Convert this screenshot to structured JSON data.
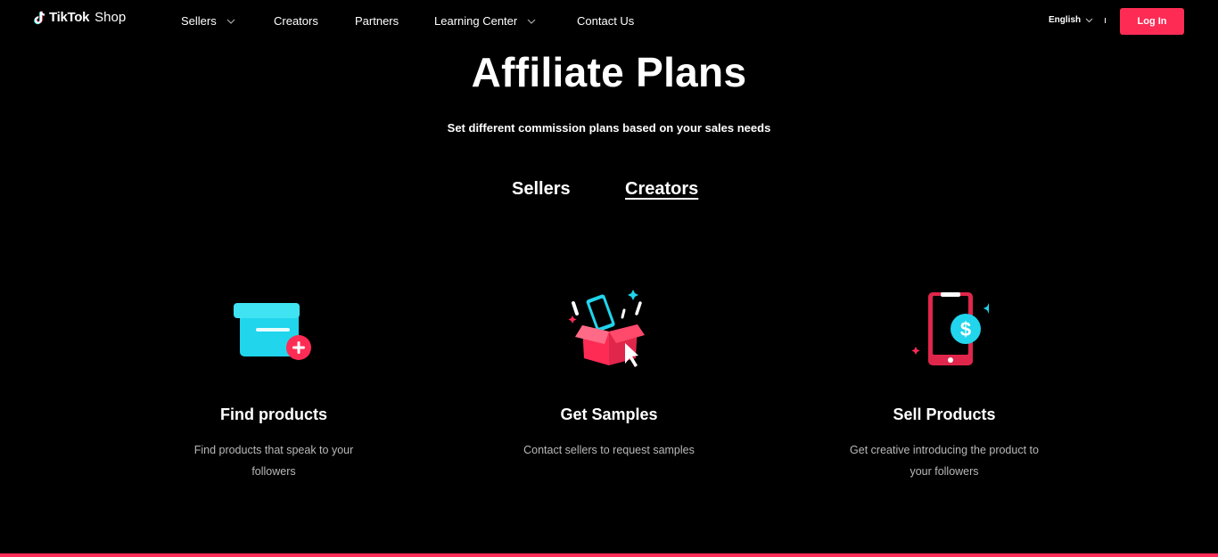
{
  "header": {
    "logo": {
      "brand": "TikTok",
      "suffix": "Shop",
      "icon": "tiktok-note-icon"
    },
    "nav": [
      {
        "label": "Sellers",
        "has_dropdown": true
      },
      {
        "label": "Creators",
        "has_dropdown": false
      },
      {
        "label": "Partners",
        "has_dropdown": false
      },
      {
        "label": "Learning Center",
        "has_dropdown": true
      },
      {
        "label": "Contact Us",
        "has_dropdown": false
      }
    ],
    "language": {
      "label": "English",
      "icon": "chevron-down-icon"
    },
    "login_label": "Log In"
  },
  "hero": {
    "title": "Affiliate Plans",
    "subtitle": "Set different commission plans based on your sales needs"
  },
  "tabs": [
    {
      "label": "Sellers",
      "active": false
    },
    {
      "label": "Creators",
      "active": true
    }
  ],
  "steps": [
    {
      "icon": "box-plus-icon",
      "title": "Find products",
      "description": "Find products that speak to your followers"
    },
    {
      "icon": "open-box-phone-icon",
      "title": "Get Samples",
      "description": "Contact sellers to request samples"
    },
    {
      "icon": "phone-dollar-icon",
      "title": "Sell Products",
      "description": "Get creative introducing the product to your followers"
    }
  ],
  "colors": {
    "background": "#000000",
    "accent": "#fe2c55",
    "cyan": "#20d5ec",
    "text": "#ffffff",
    "muted_text": "#b8b8b8"
  }
}
